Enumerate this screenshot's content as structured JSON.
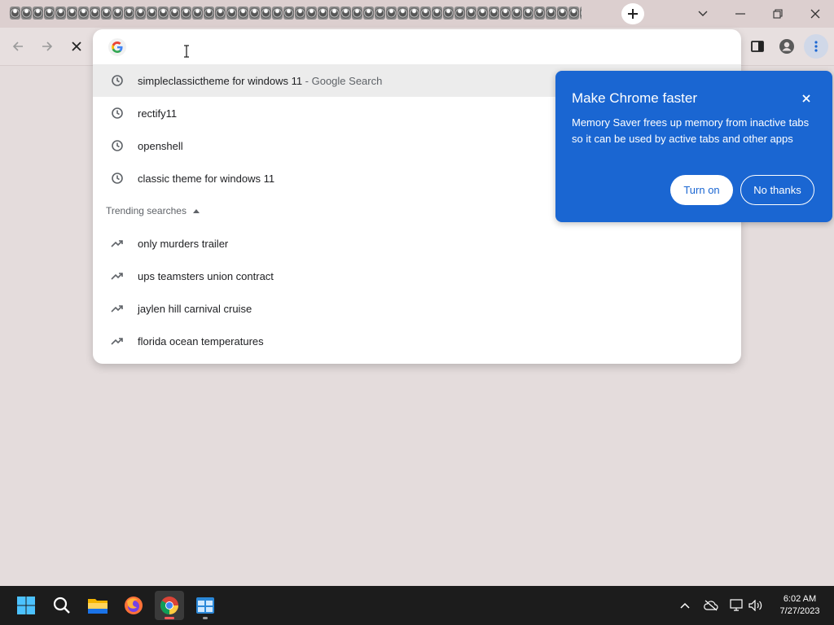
{
  "browser": {
    "tab_count": 52,
    "new_tab_icon": "plus-icon",
    "window_controls": [
      "chevron-down-icon",
      "minimize-icon",
      "restore-icon",
      "close-icon"
    ]
  },
  "toolbar": {
    "back_icon": "back-arrow-icon",
    "forward_icon": "forward-arrow-icon",
    "stop_icon": "stop-icon",
    "side_panel_icon": "side-panel-icon",
    "profile_icon": "profile-icon",
    "menu_icon": "kebab-menu-icon"
  },
  "omnibox": {
    "value": "",
    "suggestions": [
      {
        "text": "simpleclassictheme for windows 11",
        "suffix": " - Google Search",
        "icon": "history-icon"
      },
      {
        "text": "rectify11",
        "suffix": "",
        "icon": "history-icon"
      },
      {
        "text": "openshell",
        "suffix": "",
        "icon": "history-icon"
      },
      {
        "text": "classic theme for windows 11",
        "suffix": "",
        "icon": "history-icon"
      }
    ],
    "trending_label": "Trending searches",
    "trending": [
      {
        "text": "only murders trailer",
        "icon": "trending-icon"
      },
      {
        "text": "ups teamsters union contract",
        "icon": "trending-icon"
      },
      {
        "text": "jaylen hill carnival cruise",
        "icon": "trending-icon"
      },
      {
        "text": "florida ocean temperatures",
        "icon": "trending-icon"
      }
    ]
  },
  "bubble": {
    "title": "Make Chrome faster",
    "body": "Memory Saver frees up memory from inactive tabs so it can be used by active tabs and other apps",
    "turn_on": "Turn on",
    "no_thanks": "No thanks",
    "color": "#1a66d2"
  },
  "taskbar": {
    "apps": [
      "start-icon",
      "search-icon",
      "file-explorer-icon",
      "firefox-icon",
      "chrome-icon",
      "app-icon"
    ],
    "time": "6:02 AM",
    "date": "7/27/2023"
  }
}
